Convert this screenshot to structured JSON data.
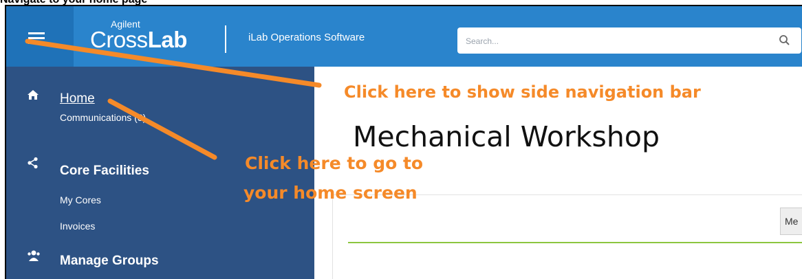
{
  "caption": "Navigate to your home page",
  "header": {
    "logo_small": "Agilent",
    "logo_cross": "Cross",
    "logo_lab": "Lab",
    "app_name": "iLab Operations Software",
    "search_placeholder": "Search...",
    "background": "#2a84cc",
    "icons": {
      "menu": "hamburger-menu-icon",
      "search": "search-icon"
    }
  },
  "sidebar": {
    "background": "#2d5284",
    "sections": [
      {
        "icon": "home-icon",
        "title": "Home",
        "items": [
          "Communications (3)"
        ]
      },
      {
        "icon": "share-icon",
        "title": "Core Facilities",
        "items": [
          "My Cores",
          "Invoices"
        ]
      },
      {
        "icon": "users-icon",
        "title": "Manage Groups",
        "items": []
      }
    ]
  },
  "main": {
    "title": "Mechanical Workshop",
    "tab_label": "Me",
    "accent_line_color": "#8cc63f"
  },
  "annotations": [
    {
      "text": "Click here to show side navigation bar"
    },
    {
      "text": "Click here to go to"
    },
    {
      "text": "your home screen"
    }
  ],
  "annotation_color": "#f58a29"
}
